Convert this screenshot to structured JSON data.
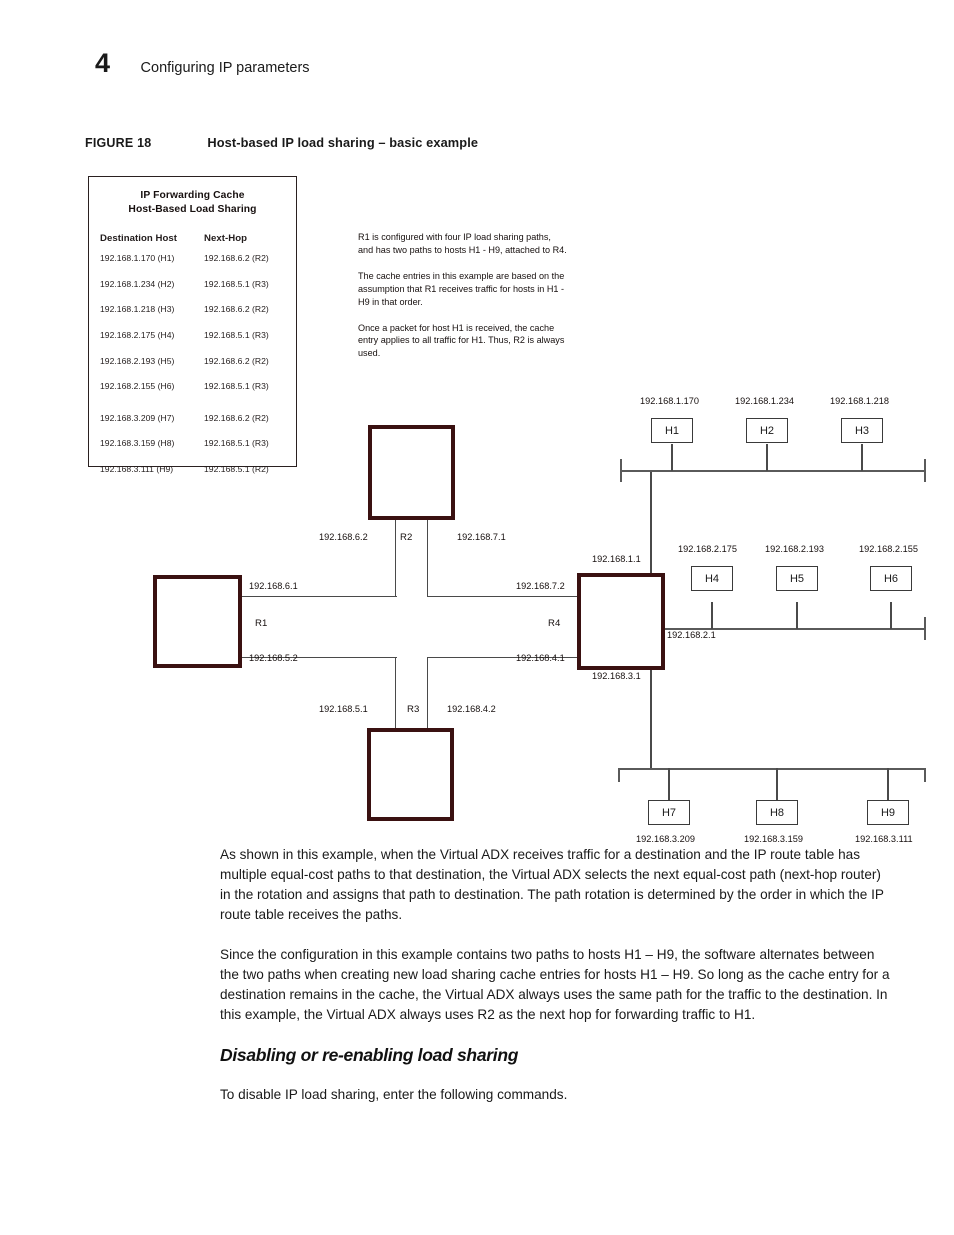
{
  "header": {
    "chapter_number": "4",
    "chapter_title": "Configuring IP parameters"
  },
  "figure": {
    "label": "FIGURE 18",
    "title": "Host-based IP load sharing – basic example"
  },
  "cache_table": {
    "title_line1": "IP Forwarding Cache",
    "title_line2": "Host-Based Load Sharing",
    "columns": [
      "Destination Host",
      "Next-Hop"
    ],
    "rows": [
      {
        "destination": "192.168.1.170 (H1)",
        "next_hop": "192.168.6.2 (R2)"
      },
      {
        "destination": "192.168.1.234 (H2)",
        "next_hop": "192.168.5.1 (R3)"
      },
      {
        "destination": "192.168.1.218 (H3)",
        "next_hop": "192.168.6.2 (R2)"
      },
      {
        "destination": "192.168.2.175 (H4)",
        "next_hop": "192.168.5.1 (R3)"
      },
      {
        "destination": "192.168.2.193 (H5)",
        "next_hop": "192.168.6.2 (R2)"
      },
      {
        "destination": "192.168.2.155 (H6)",
        "next_hop": "192.168.5.1 (R3)"
      },
      {
        "destination": "192.168.3.209 (H7)",
        "next_hop": "192.168.6.2 (R2)"
      },
      {
        "destination": "192.168.3.159 (H8)",
        "next_hop": "192.168.5.1 (R3)"
      },
      {
        "destination": "192.168.3.111 (H9)",
        "next_hop": "192.168.5.1 (R2)"
      }
    ]
  },
  "diagram_notes": [
    "R1 is configured with four IP load sharing paths, and has two paths to hosts H1 - H9, attached to R4.",
    "The cache entries in this example are based on the assumption that R1 receives traffic for hosts in H1 - H9 in that order.",
    "Once a packet for host H1 is received, the cache entry applies to all traffic for H1. Thus, R2 is always used."
  ],
  "diagram": {
    "routers": [
      {
        "id": "r1",
        "label": "R1"
      },
      {
        "id": "r2",
        "label": "R2"
      },
      {
        "id": "r3",
        "label": "R3"
      },
      {
        "id": "r4",
        "label": "R4"
      }
    ],
    "interface_labels": {
      "r1_to_r2": "192.168.6.1",
      "r2_from_r1": "192.168.6.2",
      "r2_to_r4": "192.168.7.1",
      "r4_from_r2": "192.168.7.2",
      "r1_to_r3": "192.168.5.2",
      "r3_from_r1": "192.168.5.1",
      "r3_to_r4": "192.168.4.2",
      "r4_from_r3": "192.168.4.1",
      "r4_net1": "192.168.1.1",
      "r4_net2": "192.168.2.1",
      "r4_net3": "192.168.3.1"
    },
    "hosts": [
      {
        "name": "H1",
        "ip": "192.168.1.170"
      },
      {
        "name": "H2",
        "ip": "192.168.1.234"
      },
      {
        "name": "H3",
        "ip": "192.168.1.218"
      },
      {
        "name": "H4",
        "ip": "192.168.2.175"
      },
      {
        "name": "H5",
        "ip": "192.168.2.193"
      },
      {
        "name": "H6",
        "ip": "192.168.2.155"
      },
      {
        "name": "H7",
        "ip": "192.168.3.209"
      },
      {
        "name": "H8",
        "ip": "192.168.3.159"
      },
      {
        "name": "H9",
        "ip": "192.168.3.111"
      }
    ]
  },
  "body": {
    "paragraph1": "As shown in this example, when the Virtual ADX receives traffic for a destination and the IP route table has multiple equal-cost paths to that destination, the Virtual ADX selects the next equal-cost path (next-hop router) in the rotation and assigns that path to destination. The path rotation is determined by the order in which the IP route table receives the paths.",
    "paragraph2": "Since the configuration in this example contains two paths to hosts H1 – H9, the software alternates between the two paths when creating new load sharing cache entries for hosts H1 – H9. So long as the cache entry for a destination remains in the cache, the Virtual ADX always uses the same path for the traffic to the destination. In this example, the Virtual ADX always uses R2 as the next hop for forwarding traffic to H1.",
    "section_heading": "Disabling or re-enabling load sharing",
    "paragraph3": "To disable IP load sharing, enter the following commands."
  },
  "colors": {
    "router_border": "#3a1111",
    "line": "#4a4a4a",
    "text": "#1a1a1a"
  }
}
